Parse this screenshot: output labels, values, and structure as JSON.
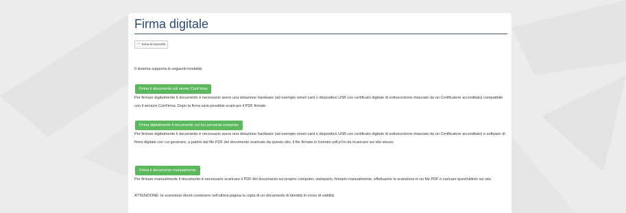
{
  "page": {
    "title": "Firma digitale",
    "back_label": "torna al cruscotto",
    "intro": "Il sistema supporta le seguenti modalità",
    "options": [
      {
        "button": "Firma il documento sul server ConFirma",
        "desc": "Per firmare digitalmente il documento è necessario avere una dotazione hardware (ad esempio smart card o dispositivo USB con certificato digitale di sottoscrizione rilasciato da un Certificatore accreditato) compatibile con il servizio ConFirma. Dopo la firma sarà possibile scaricare il PDF firmato"
      },
      {
        "button": "Firma digitalmente il documento sul tuo personal computer",
        "desc": "Per firmare digitalmente il documento è necessario avere una dotazione hardware (ad esempio smart card o dispositivo USB con certificato digitale di sottoscrizione rilasciato da un Certificatore accreditato) e software di firma digitale con cui generare, a partire dal file PDF del documento scaricato da questo sito, il file firmato in formato pdf.p7m da ricaricare sul sito stesso"
      },
      {
        "button": "Firma il documento manualmente",
        "desc": "Per firmare manualmente il documento è necessario scaricare il PDF del documento sul proprio computer, stamparlo, firmarlo manualmente, effettuarne la scansione in un file PDF e caricare quest'ultimo sul sito.",
        "warning": "ATTENZIONE: la scansione dovrà contenere nell'ultima pagina la copia di un documento di identità in corso di validità"
      }
    ]
  },
  "colors": {
    "title": "#2b4a73",
    "button_green": "#5cb85c",
    "background": "#ececec"
  },
  "icons": {
    "back": "arrow-left-icon"
  }
}
